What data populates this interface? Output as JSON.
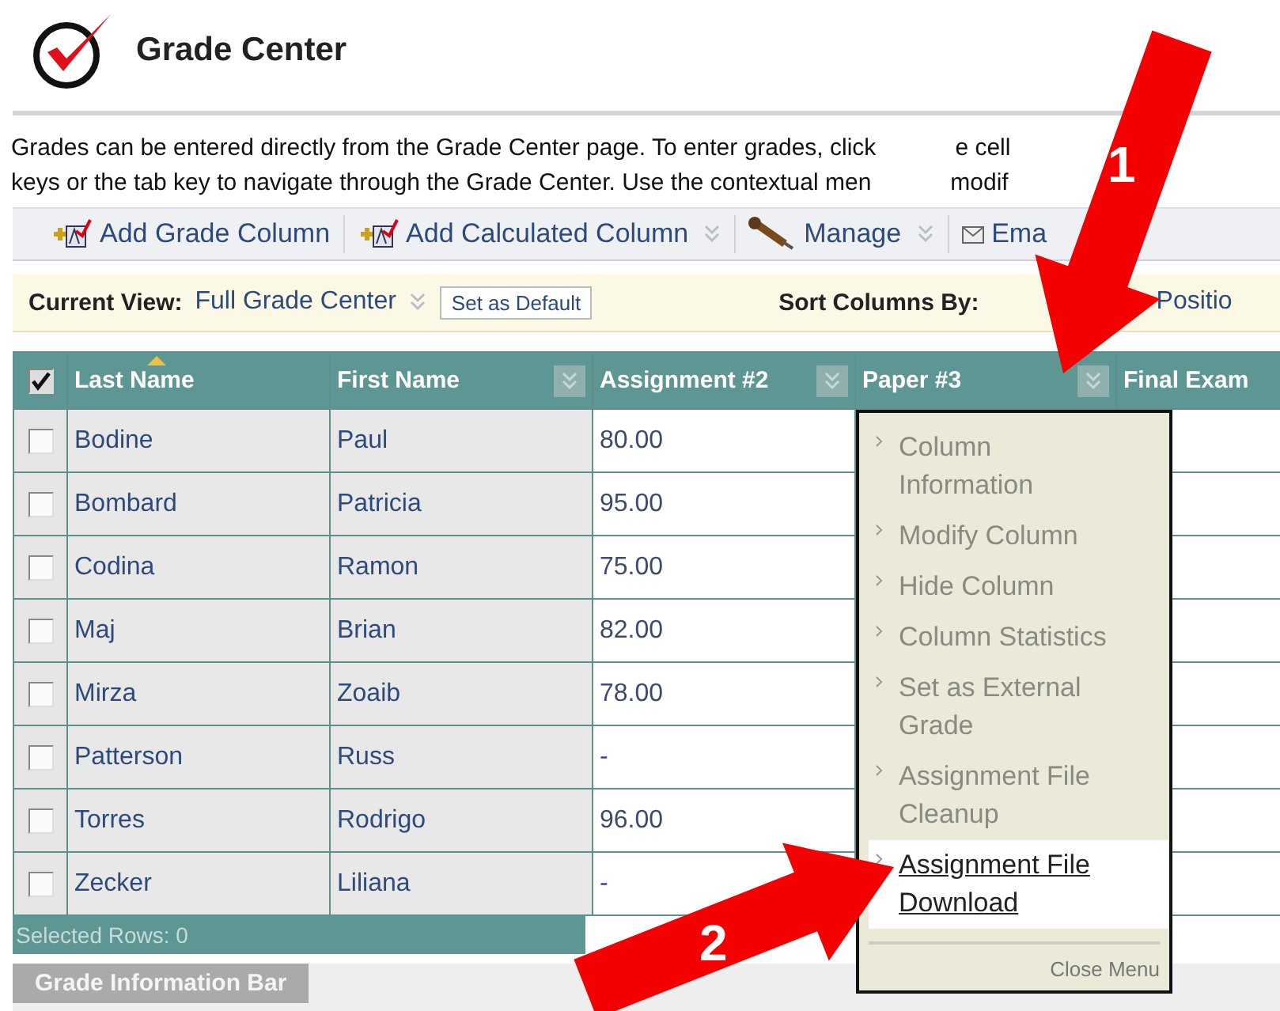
{
  "page": {
    "title": "Grade Center"
  },
  "intro": [
    {
      "text": "Grades can be entered directly from the Grade Center page. To enter grades, click",
      "tail": "e cell"
    },
    {
      "text": "keys or the tab key to navigate through the Grade Center. Use the contextual men",
      "tail": "modif"
    }
  ],
  "toolbar": [
    {
      "label": "Add Grade Column",
      "menu": false
    },
    {
      "label": "Add Calculated Column",
      "menu": true
    },
    {
      "label": "Manage",
      "menu": true
    },
    {
      "label": "Ema",
      "menu": false
    }
  ],
  "view_bar": {
    "label": "Current View:",
    "view": "Full Grade Center",
    "button": "Set as Default",
    "sort_label": "Sort Columns By:",
    "sort_value": "Positio"
  },
  "table": {
    "select_all": {
      "checked": true
    },
    "columns": [
      {
        "label": "Last Name",
        "sorted": true,
        "menu": false
      },
      {
        "label": "First Name",
        "sorted": false,
        "menu": true
      },
      {
        "label": "Assignment #2",
        "sorted": false,
        "menu": true
      },
      {
        "label": "Paper #3",
        "sorted": false,
        "menu": true
      },
      {
        "label": "Final Exam",
        "sorted": false,
        "menu": false
      }
    ],
    "rows": [
      {
        "checked": false,
        "last": "Bodine",
        "first": "Paul",
        "grade": "80.00"
      },
      {
        "checked": false,
        "last": "Bombard",
        "first": "Patricia",
        "grade": "95.00"
      },
      {
        "checked": false,
        "last": "Codina",
        "first": "Ramon",
        "grade": "75.00"
      },
      {
        "checked": false,
        "last": "Maj",
        "first": "Brian",
        "grade": "82.00"
      },
      {
        "checked": false,
        "last": "Mirza",
        "first": "Zoaib",
        "grade": "78.00"
      },
      {
        "checked": false,
        "last": "Patterson",
        "first": "Russ",
        "grade": "-"
      },
      {
        "checked": false,
        "last": "Torres",
        "first": "Rodrigo",
        "grade": "96.00"
      },
      {
        "checked": false,
        "last": "Zecker",
        "first": "Liliana",
        "grade": "-"
      }
    ],
    "footer": "Selected Rows: 0"
  },
  "column_menu": {
    "items": [
      {
        "label": "Column Information",
        "selected": false
      },
      {
        "label": "Modify Column",
        "selected": false
      },
      {
        "label": "Hide Column",
        "selected": false
      },
      {
        "label": "Column Statistics",
        "selected": false
      },
      {
        "label": "Set as External Grade",
        "selected": false
      },
      {
        "label": "Assignment File Cleanup",
        "selected": false
      },
      {
        "label": "Assignment File Download",
        "selected": true
      }
    ],
    "close": "Close Menu"
  },
  "info_tab": "Grade Information Bar",
  "callouts": [
    {
      "number": "1"
    },
    {
      "number": "2"
    }
  ]
}
